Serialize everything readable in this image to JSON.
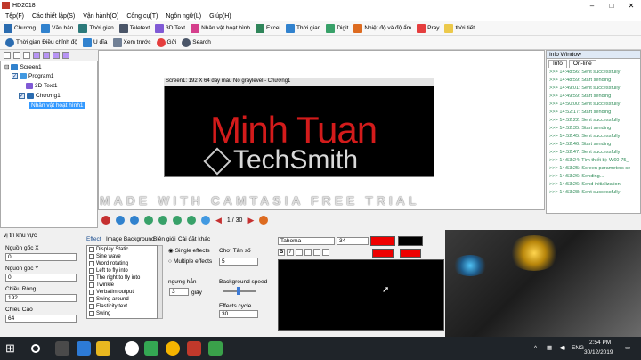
{
  "app": {
    "title": "HD2018"
  },
  "menu": [
    "Tệp(F)",
    "Các thiết lập(S)",
    "Vận hành(O)",
    "Công cụ(T)",
    "Ngôn ngữ(L)",
    "Giúp(H)"
  ],
  "toolbar1": [
    "Chương",
    "Văn bản",
    "Thời gian",
    "Teletext",
    "3D Text",
    "Nhân vật hoạt hình",
    "Excel",
    "Thời gian",
    "Digit",
    "Nhiệt độ và độ ẩm",
    "Pray",
    "thời tiết"
  ],
  "toolbar2": [
    "Thời gian Điều chỉnh độ",
    "U đĩa",
    "Xem trước",
    "Gởi",
    "Search"
  ],
  "tree": {
    "screen": "Screen1",
    "program": "Program1",
    "text3d": "3D Text1",
    "chuong": "Chương1",
    "anim": "Nhân vật hoạt hình1"
  },
  "canvas": {
    "header": "Screen1: 192 X 64  đầy màu No graylevel - Chương1",
    "display_text": "Minh Tuan",
    "watermark_brand": "TechSmith",
    "watermark_line": "MADE WITH CAMTASIA FREE TRIAL"
  },
  "nav": {
    "page": "1 / 30"
  },
  "info": {
    "title": "Info Window",
    "tabs": [
      "Info",
      "On-line"
    ],
    "log": [
      ">>> 14:48:56: Sent successfully",
      ">>> 14:48:59: Start sending",
      ">>> 14:49:01: Sent successfully",
      ">>> 14:49:59: Start sending",
      ">>> 14:50:00: Sent successfully",
      ">>> 14:52:17: Start sending",
      ">>> 14:52:22: Sent successfully",
      ">>> 14:52:35: Start sending",
      ">>> 14:52:45: Sent successfully",
      ">>> 14:52:46: Start sending",
      ">>> 14:52:47: Sent successfully",
      ">>> 14:53:24: Tìm thiết bị: W60-75_",
      ">>> 14:53:25: Screen parameters se",
      ">>> 14:53:26: Sending...",
      ">>> 14:53:26: Send initialization",
      ">>> 14:53:28: Sent successfully"
    ]
  },
  "region": {
    "title": "vị trí khu vực",
    "origin_x_label": "Nguồn gốc X",
    "origin_x": "0",
    "origin_y_label": "Nguồn gốc Y",
    "origin_y": "0",
    "width_label": "Chiều Rộng",
    "width": "192",
    "height_label": "Chiều Cao",
    "height": "64"
  },
  "effects_tabs": [
    "Effect",
    "Image Background",
    "Biên giới",
    "Cài đặt khác"
  ],
  "effects": [
    "Display Static",
    "Sine wave",
    "Word rotating",
    "Left to fly into",
    "The right to fly into",
    "Twinkle",
    "Verbatim output",
    "Swing around",
    "Elasticity text",
    "Swing"
  ],
  "effect_opts": {
    "single": "Single effects",
    "multiple": "Multiple effects",
    "play_time_label": "Chơi Tấn số",
    "play_time": "5",
    "stop_label": "ngưng hẳn",
    "stop_value": "3",
    "stop_unit": "giây",
    "bg_speed_label": "Background speed",
    "cycle_label": "Effects cycle",
    "cycle_value": "30"
  },
  "font": {
    "name": "Tahoma",
    "size": "34"
  },
  "taskbar": {
    "lang": "ENG",
    "time": "2:54 PM",
    "date": "30/12/2019"
  },
  "colors": {
    "accent": "#d31b1b",
    "log_text": "#2e8b57",
    "taskbar": "#1f2429"
  }
}
